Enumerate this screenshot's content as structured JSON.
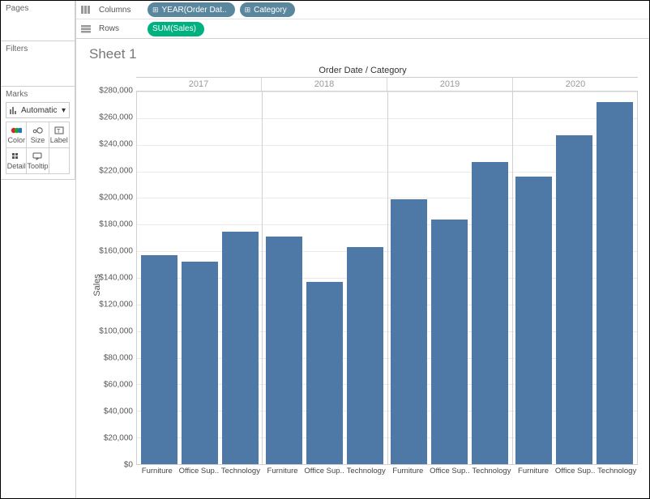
{
  "sidebar": {
    "pages_label": "Pages",
    "filters_label": "Filters",
    "marks_label": "Marks",
    "marks_select": "Automatic",
    "marks_items": {
      "color": "Color",
      "size": "Size",
      "label": "Label",
      "detail": "Detail",
      "tooltip": "Tooltip"
    }
  },
  "shelves": {
    "columns_label": "Columns",
    "rows_label": "Rows",
    "columns_pills": [
      {
        "text": "YEAR(Order Dat..",
        "prefix": "⊞"
      },
      {
        "text": "Category",
        "prefix": "⊞"
      }
    ],
    "rows_pills": [
      {
        "text": "SUM(Sales)"
      }
    ]
  },
  "sheet": {
    "title": "Sheet 1",
    "header": "Order Date / Category",
    "y_axis_title": "Sales"
  },
  "chart_data": {
    "type": "bar",
    "group_field": "YEAR(Order Date)",
    "category_field": "Category",
    "categories": [
      "Furniture",
      "Office Sup..",
      "Technology"
    ],
    "groups": [
      "2017",
      "2018",
      "2019",
      "2020"
    ],
    "series": [
      {
        "name": "2017",
        "values": [
          157000,
          152000,
          175000
        ]
      },
      {
        "name": "2018",
        "values": [
          171000,
          137000,
          163000
        ]
      },
      {
        "name": "2019",
        "values": [
          199000,
          184000,
          227000
        ]
      },
      {
        "name": "2020",
        "values": [
          216000,
          247000,
          272000
        ]
      }
    ],
    "ylabel": "Sales",
    "ylim": [
      0,
      280000
    ],
    "y_tick_step": 20000,
    "y_tick_labels": [
      "$0",
      "$20,000",
      "$40,000",
      "$60,000",
      "$80,000",
      "$100,000",
      "$120,000",
      "$140,000",
      "$160,000",
      "$180,000",
      "$200,000",
      "$220,000",
      "$240,000",
      "$260,000",
      "$280,000"
    ],
    "bar_color": "#4e79a7",
    "title": "Order Date / Category"
  }
}
